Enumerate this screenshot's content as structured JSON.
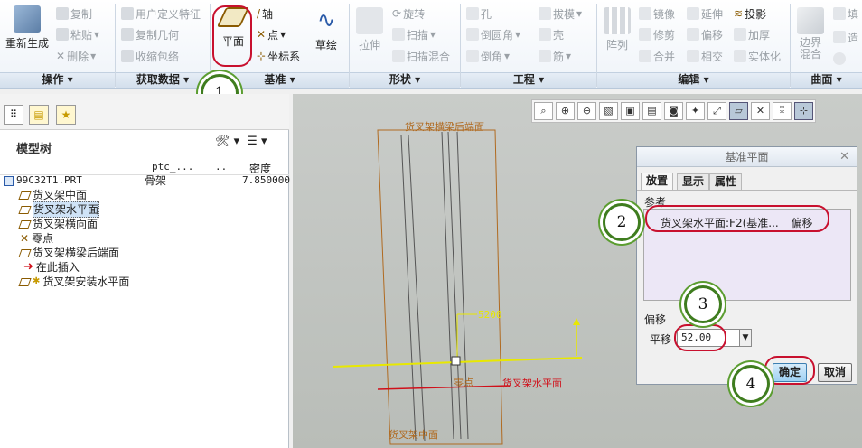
{
  "ribbon": {
    "groups": [
      "操作",
      "获取数据",
      "基准",
      "形状",
      "工程",
      "编辑",
      "曲面"
    ],
    "operations": {
      "regenerate": "重新生成",
      "copy": "复制",
      "paste": "粘贴",
      "delete": "删除"
    },
    "get_data": {
      "udf": "用户定义特征",
      "copy_geometry": "复制几何",
      "shrinkwrap": "收缩包络"
    },
    "datum": {
      "plane": "平面",
      "axis": "轴",
      "point": "点",
      "csys": "坐标系",
      "sketch": "草绘"
    },
    "shapes": {
      "extrude": "拉伸",
      "revolve": "旋转",
      "sweep": "扫描",
      "swept_blend": "扫描混合"
    },
    "engineering": {
      "hole": "孔",
      "round": "倒圆角",
      "chamfer": "倒角",
      "draft": "拔模",
      "shell": "壳",
      "rib": "筋"
    },
    "editing": {
      "pattern": "阵列",
      "mirror": "镜像",
      "extend": "延伸",
      "project": "投影",
      "trim": "修剪",
      "offset": "偏移",
      "thicken": "加厚",
      "merge": "合并",
      "intersect": "相交",
      "solidify": "实体化"
    },
    "surfaces": {
      "boundary_blend": "边界混合",
      "fill": "填",
      "style": "造"
    }
  },
  "model_tree": {
    "title": "模型树",
    "columns": [
      "ptc_...",
      "..",
      "密度"
    ],
    "root": {
      "name": "99C32T1.PRT",
      "c1": "骨架",
      "c3": "7.850000"
    },
    "items": [
      {
        "label": "货叉架中面",
        "selected": false
      },
      {
        "label": "货叉架水平面",
        "selected": true
      },
      {
        "label": "货叉架横向面",
        "selected": false
      },
      {
        "label": "零点",
        "selected": false
      },
      {
        "label": "货叉架横梁后端面",
        "selected": false
      },
      {
        "label": "在此插入",
        "selected": false
      },
      {
        "label": "货叉架安装水平面",
        "selected": false
      }
    ]
  },
  "viewport": {
    "labels": {
      "top": "货叉架横梁后端面",
      "dim": "5200",
      "zero": "零点",
      "horizontal_plane": "货叉架水平面",
      "bottom": "货叉架中面"
    }
  },
  "dialog": {
    "title": "基准平面",
    "tabs": [
      "放置",
      "显示",
      "属性"
    ],
    "references_label": "参考",
    "reference_item": "货叉架水平面:F2(基准...",
    "reference_type": "偏移",
    "offset_label": "偏移",
    "offset_type": "平移",
    "offset_value": "52.00",
    "ok": "确定",
    "cancel": "取消"
  },
  "callouts": [
    "1",
    "2",
    "3",
    "4"
  ],
  "colors": {
    "highlight": "#c8102e",
    "callout_border": "#3f7d1f",
    "datum_plane": "#8a5a00",
    "selected_plane": "#e8e800"
  }
}
